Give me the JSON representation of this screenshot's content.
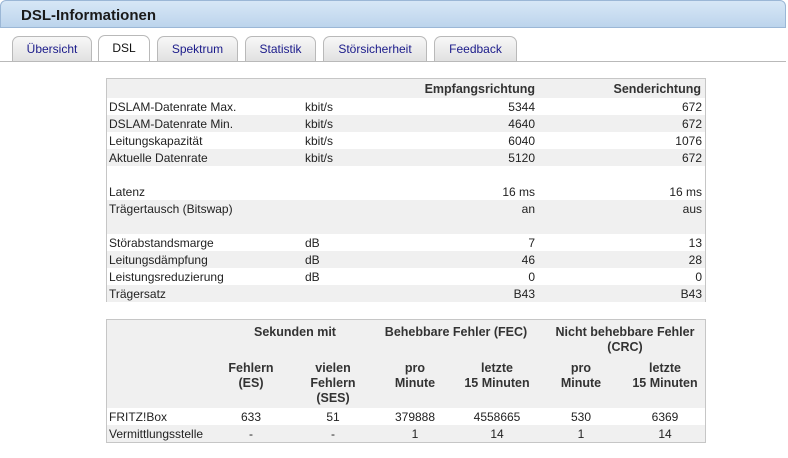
{
  "window": {
    "title": "DSL-Informationen"
  },
  "tabs": [
    {
      "label": "Übersicht"
    },
    {
      "label": "DSL"
    },
    {
      "label": "Spektrum"
    },
    {
      "label": "Statistik"
    },
    {
      "label": "Störsicherheit"
    },
    {
      "label": "Feedback"
    }
  ],
  "active_tab": "DSL",
  "line_table": {
    "header": {
      "receive": "Empfangsrichtung",
      "send": "Senderichtung"
    },
    "rows": [
      {
        "label": "DSLAM-Datenrate Max.",
        "unit": "kbit/s",
        "receive": "5344",
        "send": "672"
      },
      {
        "label": "DSLAM-Datenrate Min.",
        "unit": "kbit/s",
        "receive": "4640",
        "send": "672"
      },
      {
        "label": "Leitungskapazität",
        "unit": "kbit/s",
        "receive": "6040",
        "send": "1076"
      },
      {
        "label": "Aktuelle Datenrate",
        "unit": "kbit/s",
        "receive": "5120",
        "send": "672"
      },
      {
        "label": "Latenz",
        "unit": "",
        "receive": "16 ms",
        "send": "16 ms"
      },
      {
        "label": "Trägertausch (Bitswap)",
        "unit": "",
        "receive": "an",
        "send": "aus"
      },
      {
        "label": "Störabstandsmarge",
        "unit": "dB",
        "receive": "7",
        "send": "13"
      },
      {
        "label": "Leitungsdämpfung",
        "unit": "dB",
        "receive": "46",
        "send": "28"
      },
      {
        "label": "Leistungsreduzierung",
        "unit": "dB",
        "receive": "0",
        "send": "0"
      },
      {
        "label": "Trägersatz",
        "unit": "",
        "receive": "B43",
        "send": "B43"
      }
    ]
  },
  "error_table": {
    "group_headers": {
      "seconds": "Sekunden mit",
      "fec": "Behebbare Fehler (FEC)",
      "crc_line1": "Nicht behebbare Fehler",
      "crc_line2": "(CRC)"
    },
    "sub_headers": {
      "es": [
        "Fehlern",
        "(ES)"
      ],
      "ses": [
        "vielen",
        "Fehlern",
        "(SES)"
      ],
      "fec_min": [
        "pro",
        "Minute"
      ],
      "fec_15": [
        "letzte",
        "15 Minuten"
      ],
      "crc_min": [
        "pro",
        "Minute"
      ],
      "crc_15": [
        "letzte",
        "15 Minuten"
      ]
    },
    "rows": [
      {
        "label": "FRITZ!Box",
        "es": "633",
        "ses": "51",
        "fec_min": "379888",
        "fec_15": "4558665",
        "crc_min": "530",
        "crc_15": "6369"
      },
      {
        "label": "Vermittlungsstelle",
        "es": "-",
        "ses": "-",
        "fec_min": "1",
        "fec_15": "14",
        "crc_min": "1",
        "crc_15": "14"
      }
    ]
  }
}
